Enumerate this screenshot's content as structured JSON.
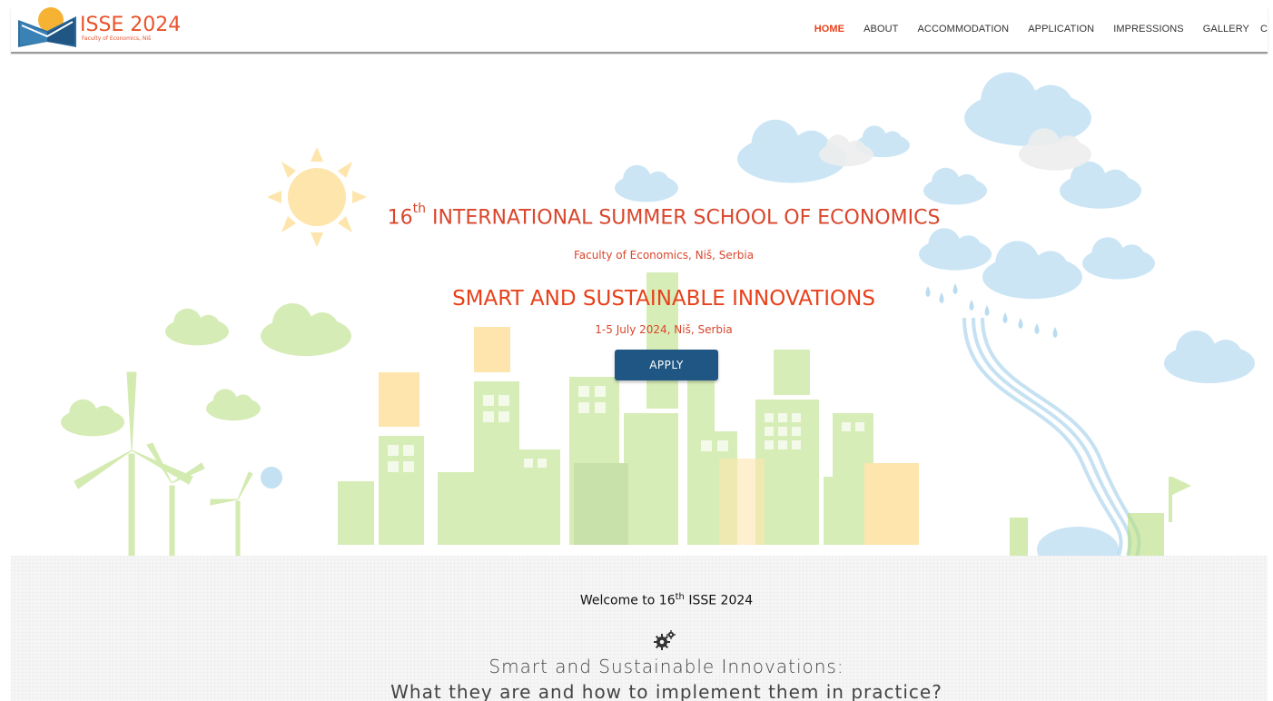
{
  "logo": {
    "title": "ISSE 2024",
    "subtitle": "Faculty of Economics, Niš"
  },
  "nav": {
    "items": [
      "HOME",
      "ABOUT",
      "ACCOMMODATION",
      "APPLICATION",
      "IMPRESSIONS",
      "GALLERY"
    ],
    "truncated": "C",
    "active": "HOME"
  },
  "hero": {
    "title_number": "16",
    "title_suffix": "th",
    "title_rest": " INTERNATIONAL SUMMER SCHOOL OF ECONOMICS",
    "subtitle": "Faculty of Economics, Niš, Serbia",
    "theme": "SMART AND SUSTAINABLE INNOVATIONS",
    "dates": "1-5 July 2024, Niš, Serbia",
    "apply_label": "APPLY"
  },
  "welcome": {
    "title_prefix": "Welcome to 16",
    "title_suffix": "th",
    "title_rest": " ISSE 2024",
    "icon": "gears-icon",
    "heading_line1": "Smart and Sustainable Innovations:",
    "heading_line2": "What they are and how to implement them in practice?"
  },
  "colors": {
    "accent": "#e8411b",
    "button": "#1f5683",
    "cloud": "#9fcdea",
    "green": "#b6de7c",
    "sun": "#fcd06a"
  }
}
